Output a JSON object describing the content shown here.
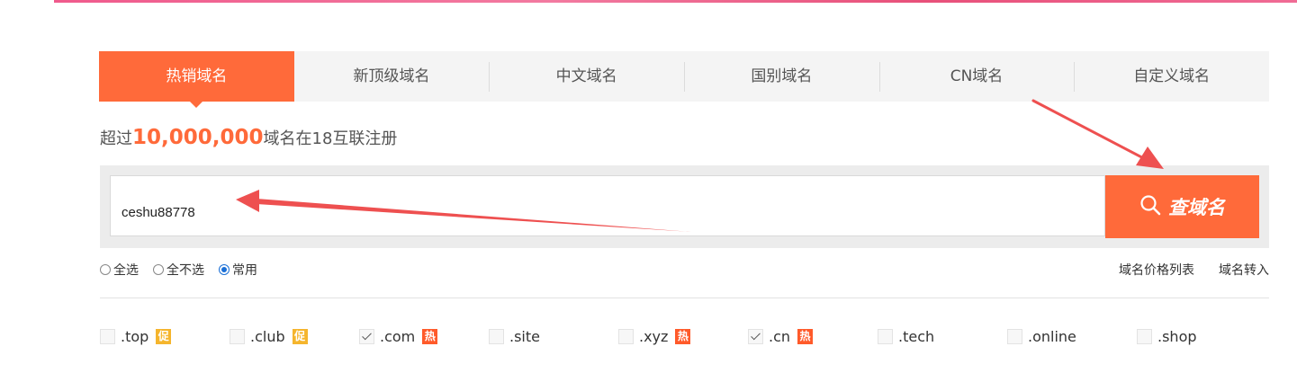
{
  "tabs": [
    {
      "label": "热销域名",
      "active": true
    },
    {
      "label": "新顶级域名",
      "active": false
    },
    {
      "label": "中文域名",
      "active": false
    },
    {
      "label": "国别域名",
      "active": false
    },
    {
      "label": "CN域名",
      "active": false
    },
    {
      "label": "自定义域名",
      "active": false
    }
  ],
  "headline": {
    "prefix": "超过",
    "count": "10,000,000",
    "suffix": "域名在18互联注册"
  },
  "search": {
    "value": "ceshu88778",
    "button_label": "查域名",
    "button_icon": "search-icon"
  },
  "select_options": [
    {
      "label": "全选",
      "checked": false
    },
    {
      "label": "全不选",
      "checked": false
    },
    {
      "label": "常用",
      "checked": true
    }
  ],
  "links": {
    "price_list": "域名价格列表",
    "transfer": "域名转入"
  },
  "tlds": [
    {
      "name": ".top",
      "checked": false,
      "badge": "促",
      "badge_type": "promo"
    },
    {
      "name": ".club",
      "checked": false,
      "badge": "促",
      "badge_type": "promo"
    },
    {
      "name": ".com",
      "checked": true,
      "badge": "热",
      "badge_type": "hot"
    },
    {
      "name": ".site",
      "checked": false,
      "badge": "",
      "badge_type": ""
    },
    {
      "name": ".xyz",
      "checked": false,
      "badge": "热",
      "badge_type": "hot"
    },
    {
      "name": ".cn",
      "checked": true,
      "badge": "热",
      "badge_type": "hot"
    },
    {
      "name": ".tech",
      "checked": false,
      "badge": "",
      "badge_type": ""
    },
    {
      "name": ".online",
      "checked": false,
      "badge": "",
      "badge_type": ""
    },
    {
      "name": ".shop",
      "checked": false,
      "badge": "",
      "badge_type": ""
    }
  ],
  "colors": {
    "accent": "#ff6a3a",
    "annotation": "#ee5050",
    "promo": "#f5b52d",
    "hot": "#ff5a2a"
  }
}
